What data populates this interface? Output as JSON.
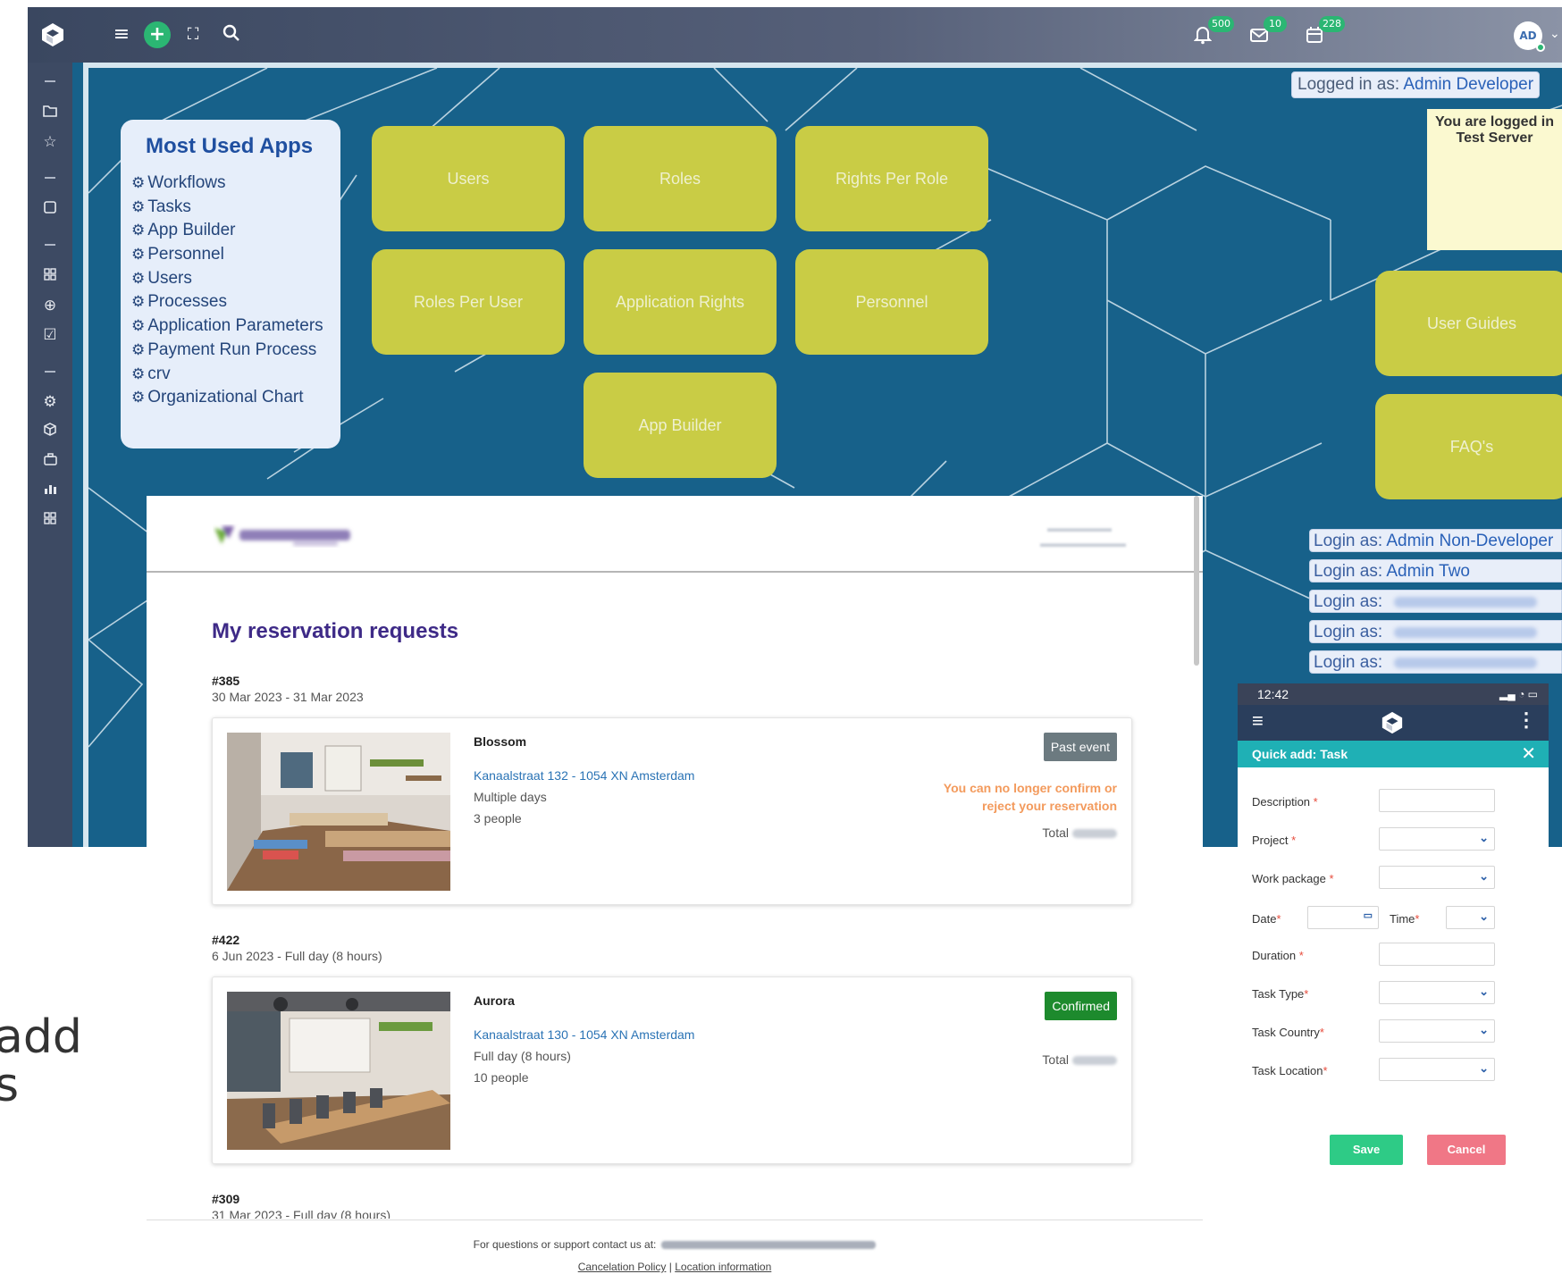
{
  "app": {
    "notifications": [
      {
        "icon": "bell-icon",
        "count": "500"
      },
      {
        "icon": "mail-icon",
        "count": "10"
      },
      {
        "icon": "calendar-icon",
        "count": "228"
      }
    ],
    "avatar_initials": "AD",
    "avatar_status_color": "#2bb673",
    "accent_green": "#2bb673"
  },
  "sidebar": {
    "icons": [
      "folder-icon",
      "star-icon",
      "square-icon",
      "grid-icon",
      "plus-circle-icon",
      "checkbox-icon",
      "settings-icon",
      "cube-icon",
      "briefcase-icon",
      "bar-chart-icon",
      "apps-icon"
    ]
  },
  "most_used": {
    "title": "Most Used Apps",
    "items": [
      "Workflows",
      "Tasks",
      "App Builder",
      "Personnel",
      "Users",
      "Processes",
      "Application Parameters",
      "Payment Run Process",
      "crv",
      "Organizational Chart"
    ]
  },
  "tiles": [
    "Users",
    "Roles",
    "Rights Per Role",
    "Roles Per User",
    "Application Rights",
    "Personnel",
    "App Builder",
    "User Guides",
    "FAQ's"
  ],
  "login": {
    "logged_in_prefix": "Logged in as:",
    "logged_in_user": "Admin Developer",
    "server_note": "You are logged in\nTest Server",
    "login_as_prefix": "Login as:",
    "options": [
      "Admin Non-Developer",
      "Admin Two",
      "",
      "",
      ""
    ]
  },
  "reservations": {
    "title": "My reservation requests",
    "items": [
      {
        "number": "#385",
        "dates": "30 Mar 2023 - 31 Mar 2023",
        "name": "Blossom",
        "address": "Kanaalstraat 132 - 1054 XN Amsterdam",
        "duration": "Multiple days",
        "people": "3 people",
        "status": "Past event",
        "status_color": "#6c7a80",
        "warning": "You can no longer confirm or reject your reservation",
        "total_label": "Total"
      },
      {
        "number": "#422",
        "dates": "6 Jun 2023 - Full day (8 hours)",
        "name": "Aurora",
        "address": "Kanaalstraat 130 - 1054 XN Amsterdam",
        "duration": "Full day (8 hours)",
        "people": "10 people",
        "status": "Confirmed",
        "status_color": "#1d8a2d",
        "warning": "",
        "total_label": "Total"
      },
      {
        "number": "#309",
        "dates": "31 Mar 2023 - Full day (8 hours)"
      }
    ],
    "footer_text": "For questions or support contact us at:",
    "footer_links": [
      "Cancelation Policy",
      "Location information"
    ],
    "footer_separator": "|"
  },
  "quick_add": {
    "time": "12:42",
    "title": "Quick add: Task",
    "fields": [
      {
        "label": "Description",
        "required_mark": " *",
        "type": "text"
      },
      {
        "label": "Project",
        "required_mark": " *",
        "type": "select"
      },
      {
        "label": "Work package",
        "required_mark": " *",
        "type": "select"
      },
      {
        "label": "Date",
        "required_mark": "*",
        "type": "date"
      },
      {
        "label": "Duration",
        "required_mark": " *",
        "type": "text"
      },
      {
        "label": "Task Type",
        "required_mark": "*",
        "type": "select"
      },
      {
        "label": "Task Country",
        "required_mark": "*",
        "type": "select"
      },
      {
        "label": "Task Location",
        "required_mark": "*",
        "type": "select"
      }
    ],
    "time_label": "Time",
    "time_required_mark": "*",
    "save_label": "Save",
    "cancel_label": "Cancel"
  },
  "overlay_text": {
    "line1": "add",
    "line2": "s"
  }
}
